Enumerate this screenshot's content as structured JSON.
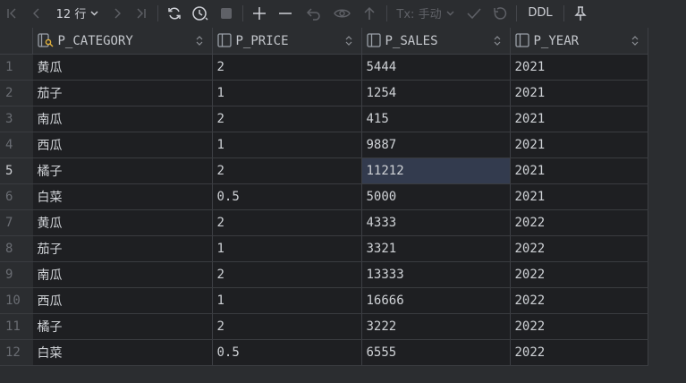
{
  "toolbar": {
    "rows_label": "12 行",
    "tx_label": "Tx: 手动",
    "ddl_label": "DDL"
  },
  "columns": [
    {
      "name": "P_CATEGORY",
      "icon": "key-column-icon"
    },
    {
      "name": "P_PRICE",
      "icon": "column-icon"
    },
    {
      "name": "P_SALES",
      "icon": "column-icon"
    },
    {
      "name": "P_YEAR",
      "icon": "column-icon"
    }
  ],
  "rows": [
    {
      "n": "1",
      "cells": [
        "黄瓜",
        "2",
        "5444",
        "2021"
      ]
    },
    {
      "n": "2",
      "cells": [
        "茄子",
        "1",
        "1254",
        "2021"
      ]
    },
    {
      "n": "3",
      "cells": [
        "南瓜",
        "2",
        "415",
        "2021"
      ]
    },
    {
      "n": "4",
      "cells": [
        "西瓜",
        "1",
        "9887",
        "2021"
      ]
    },
    {
      "n": "5",
      "cells": [
        "橘子",
        "2",
        "11212",
        "2021"
      ]
    },
    {
      "n": "6",
      "cells": [
        "白菜",
        "0.5",
        "5000",
        "2021"
      ]
    },
    {
      "n": "7",
      "cells": [
        "黄瓜",
        "2",
        "4333",
        "2022"
      ]
    },
    {
      "n": "8",
      "cells": [
        "茄子",
        "1",
        "3321",
        "2022"
      ]
    },
    {
      "n": "9",
      "cells": [
        "南瓜",
        "2",
        "13333",
        "2022"
      ]
    },
    {
      "n": "10",
      "cells": [
        "西瓜",
        "1",
        "16666",
        "2022"
      ]
    },
    {
      "n": "11",
      "cells": [
        "橘子",
        "2",
        "3222",
        "2022"
      ]
    },
    {
      "n": "12",
      "cells": [
        "白菜",
        "0.5",
        "6555",
        "2022"
      ]
    }
  ]
}
